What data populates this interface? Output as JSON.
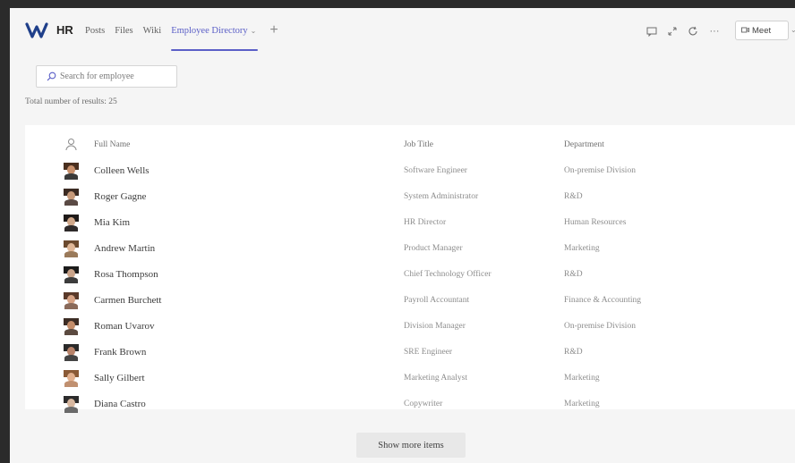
{
  "header": {
    "team_name": "HR",
    "tabs": [
      {
        "label": "Posts"
      },
      {
        "label": "Files"
      },
      {
        "label": "Wiki"
      },
      {
        "label": "Employee Directory",
        "active": true
      }
    ],
    "add_tab": "+",
    "more_label": "···",
    "meet_label": "Meet"
  },
  "search": {
    "placeholder": "Search for employee",
    "value": ""
  },
  "result_count": "Total number of results: 25",
  "table": {
    "headers": {
      "name": "Full Name",
      "job": "Job Title",
      "dept": "Department"
    },
    "rows": [
      {
        "name": "Colleen Wells",
        "job": "Software Engineer",
        "dept": "On-premise Division"
      },
      {
        "name": "Roger Gagne",
        "job": "System Administrator",
        "dept": "R&D"
      },
      {
        "name": "Mia Kim",
        "job": "HR Director",
        "dept": "Human Resources"
      },
      {
        "name": "Andrew Martin",
        "job": "Product Manager",
        "dept": "Marketing"
      },
      {
        "name": "Rosa Thompson",
        "job": "Chief Technology Officer",
        "dept": "R&D"
      },
      {
        "name": "Carmen Burchett",
        "job": "Payroll Accountant",
        "dept": "Finance & Accounting"
      },
      {
        "name": "Roman Uvarov",
        "job": "Division Manager",
        "dept": "On-premise Division"
      },
      {
        "name": "Frank Brown",
        "job": "SRE Engineer",
        "dept": "R&D"
      },
      {
        "name": "Sally Gilbert",
        "job": "Marketing Analyst",
        "dept": "Marketing"
      },
      {
        "name": "Diana Castro",
        "job": "Copywriter",
        "dept": "Marketing"
      }
    ]
  },
  "show_more_label": "Show more items",
  "colors": {
    "accent": "#5b5fc7",
    "background": "#f5f5f5",
    "card": "#ffffff"
  },
  "icons": [
    "teams-logo-icon",
    "person-icon",
    "search-icon",
    "chat-icon",
    "expand-icon",
    "refresh-icon",
    "more-icon",
    "video-camera-icon",
    "chevron-down-icon"
  ]
}
